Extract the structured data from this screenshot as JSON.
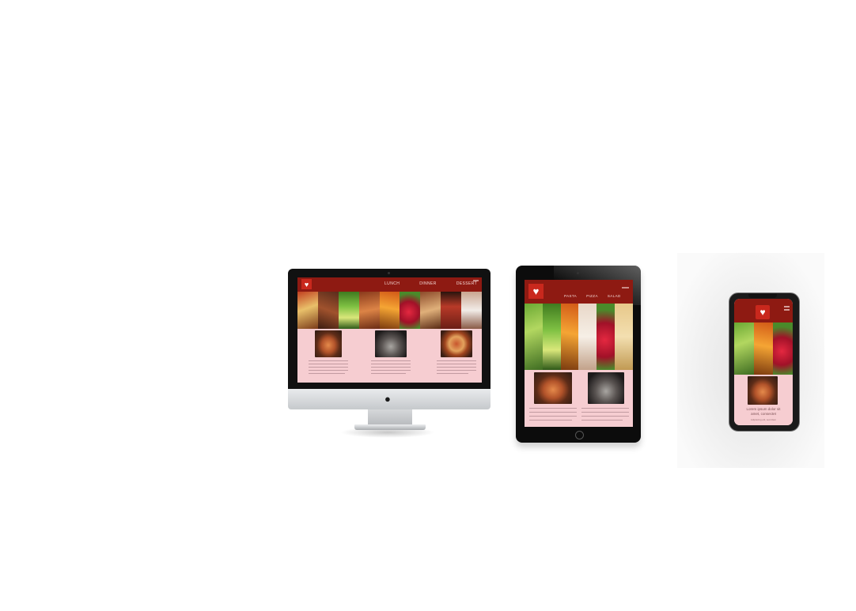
{
  "site": {
    "logo_icon": "heart-icon",
    "colors": {
      "header": "#8e1a12",
      "logo": "#c9281d",
      "content_bg": "#f6cdd1",
      "nav_text": "#f3d9d6"
    }
  },
  "desktop": {
    "nav": [
      "LUNCH",
      "DINNER",
      "DESSERT"
    ]
  },
  "tablet": {
    "nav": [
      "PASTA",
      "PIZZA",
      "SALAD"
    ]
  },
  "phone": {
    "heading_line1": "Lorem ipsum dolor sit",
    "heading_line2": "amet, consectet",
    "subtext": "Adipiscing elit, sed diam"
  }
}
